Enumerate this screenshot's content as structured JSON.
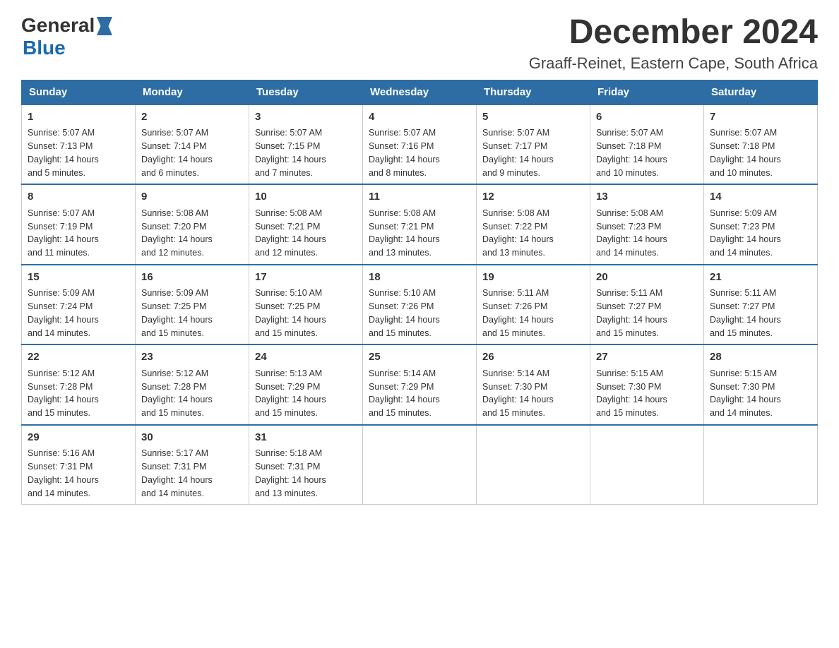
{
  "logo": {
    "text_general": "General",
    "text_blue": "Blue"
  },
  "header": {
    "title": "December 2024",
    "subtitle": "Graaff-Reinet, Eastern Cape, South Africa"
  },
  "days_of_week": [
    "Sunday",
    "Monday",
    "Tuesday",
    "Wednesday",
    "Thursday",
    "Friday",
    "Saturday"
  ],
  "weeks": [
    [
      {
        "day": "1",
        "sunrise": "5:07 AM",
        "sunset": "7:13 PM",
        "daylight": "14 hours and 5 minutes."
      },
      {
        "day": "2",
        "sunrise": "5:07 AM",
        "sunset": "7:14 PM",
        "daylight": "14 hours and 6 minutes."
      },
      {
        "day": "3",
        "sunrise": "5:07 AM",
        "sunset": "7:15 PM",
        "daylight": "14 hours and 7 minutes."
      },
      {
        "day": "4",
        "sunrise": "5:07 AM",
        "sunset": "7:16 PM",
        "daylight": "14 hours and 8 minutes."
      },
      {
        "day": "5",
        "sunrise": "5:07 AM",
        "sunset": "7:17 PM",
        "daylight": "14 hours and 9 minutes."
      },
      {
        "day": "6",
        "sunrise": "5:07 AM",
        "sunset": "7:18 PM",
        "daylight": "14 hours and 10 minutes."
      },
      {
        "day": "7",
        "sunrise": "5:07 AM",
        "sunset": "7:18 PM",
        "daylight": "14 hours and 10 minutes."
      }
    ],
    [
      {
        "day": "8",
        "sunrise": "5:07 AM",
        "sunset": "7:19 PM",
        "daylight": "14 hours and 11 minutes."
      },
      {
        "day": "9",
        "sunrise": "5:08 AM",
        "sunset": "7:20 PM",
        "daylight": "14 hours and 12 minutes."
      },
      {
        "day": "10",
        "sunrise": "5:08 AM",
        "sunset": "7:21 PM",
        "daylight": "14 hours and 12 minutes."
      },
      {
        "day": "11",
        "sunrise": "5:08 AM",
        "sunset": "7:21 PM",
        "daylight": "14 hours and 13 minutes."
      },
      {
        "day": "12",
        "sunrise": "5:08 AM",
        "sunset": "7:22 PM",
        "daylight": "14 hours and 13 minutes."
      },
      {
        "day": "13",
        "sunrise": "5:08 AM",
        "sunset": "7:23 PM",
        "daylight": "14 hours and 14 minutes."
      },
      {
        "day": "14",
        "sunrise": "5:09 AM",
        "sunset": "7:23 PM",
        "daylight": "14 hours and 14 minutes."
      }
    ],
    [
      {
        "day": "15",
        "sunrise": "5:09 AM",
        "sunset": "7:24 PM",
        "daylight": "14 hours and 14 minutes."
      },
      {
        "day": "16",
        "sunrise": "5:09 AM",
        "sunset": "7:25 PM",
        "daylight": "14 hours and 15 minutes."
      },
      {
        "day": "17",
        "sunrise": "5:10 AM",
        "sunset": "7:25 PM",
        "daylight": "14 hours and 15 minutes."
      },
      {
        "day": "18",
        "sunrise": "5:10 AM",
        "sunset": "7:26 PM",
        "daylight": "14 hours and 15 minutes."
      },
      {
        "day": "19",
        "sunrise": "5:11 AM",
        "sunset": "7:26 PM",
        "daylight": "14 hours and 15 minutes."
      },
      {
        "day": "20",
        "sunrise": "5:11 AM",
        "sunset": "7:27 PM",
        "daylight": "14 hours and 15 minutes."
      },
      {
        "day": "21",
        "sunrise": "5:11 AM",
        "sunset": "7:27 PM",
        "daylight": "14 hours and 15 minutes."
      }
    ],
    [
      {
        "day": "22",
        "sunrise": "5:12 AM",
        "sunset": "7:28 PM",
        "daylight": "14 hours and 15 minutes."
      },
      {
        "day": "23",
        "sunrise": "5:12 AM",
        "sunset": "7:28 PM",
        "daylight": "14 hours and 15 minutes."
      },
      {
        "day": "24",
        "sunrise": "5:13 AM",
        "sunset": "7:29 PM",
        "daylight": "14 hours and 15 minutes."
      },
      {
        "day": "25",
        "sunrise": "5:14 AM",
        "sunset": "7:29 PM",
        "daylight": "14 hours and 15 minutes."
      },
      {
        "day": "26",
        "sunrise": "5:14 AM",
        "sunset": "7:30 PM",
        "daylight": "14 hours and 15 minutes."
      },
      {
        "day": "27",
        "sunrise": "5:15 AM",
        "sunset": "7:30 PM",
        "daylight": "14 hours and 15 minutes."
      },
      {
        "day": "28",
        "sunrise": "5:15 AM",
        "sunset": "7:30 PM",
        "daylight": "14 hours and 14 minutes."
      }
    ],
    [
      {
        "day": "29",
        "sunrise": "5:16 AM",
        "sunset": "7:31 PM",
        "daylight": "14 hours and 14 minutes."
      },
      {
        "day": "30",
        "sunrise": "5:17 AM",
        "sunset": "7:31 PM",
        "daylight": "14 hours and 14 minutes."
      },
      {
        "day": "31",
        "sunrise": "5:18 AM",
        "sunset": "7:31 PM",
        "daylight": "14 hours and 13 minutes."
      },
      null,
      null,
      null,
      null
    ]
  ],
  "labels": {
    "sunrise": "Sunrise:",
    "sunset": "Sunset:",
    "daylight": "Daylight:"
  }
}
